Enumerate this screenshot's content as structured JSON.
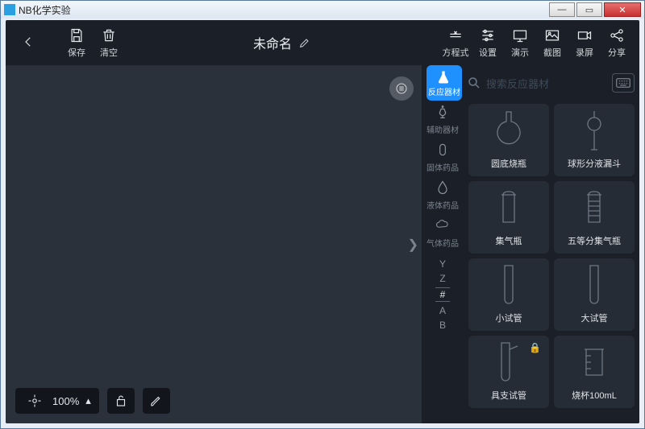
{
  "window": {
    "title": "NB化学实验"
  },
  "toolbar": {
    "save": "保存",
    "clear": "清空",
    "title": "未命名",
    "equation": "方程式",
    "settings": "设置",
    "present": "演示",
    "screenshot": "截图",
    "record": "录屏",
    "share": "分享"
  },
  "zoom": {
    "value": "100%"
  },
  "search": {
    "placeholder": "搜索反应器材"
  },
  "categories": {
    "active": "反应器材",
    "list": [
      "辅助器材",
      "固体药品",
      "液体药品",
      "气体药品"
    ]
  },
  "indexLetters": [
    "Y",
    "Z",
    "#",
    "A",
    "B"
  ],
  "items": [
    {
      "name": "圆底烧瓶",
      "shape": "round-flask"
    },
    {
      "name": "球形分液漏斗",
      "shape": "sep-funnel"
    },
    {
      "name": "集气瓶",
      "shape": "jar"
    },
    {
      "name": "五等分集气瓶",
      "shape": "jar-grad"
    },
    {
      "name": "小试管",
      "shape": "tube"
    },
    {
      "name": "大试管",
      "shape": "tube"
    },
    {
      "name": "具支试管",
      "shape": "tube-side",
      "locked": true
    },
    {
      "name": "烧杯100mL",
      "shape": "beaker"
    }
  ]
}
